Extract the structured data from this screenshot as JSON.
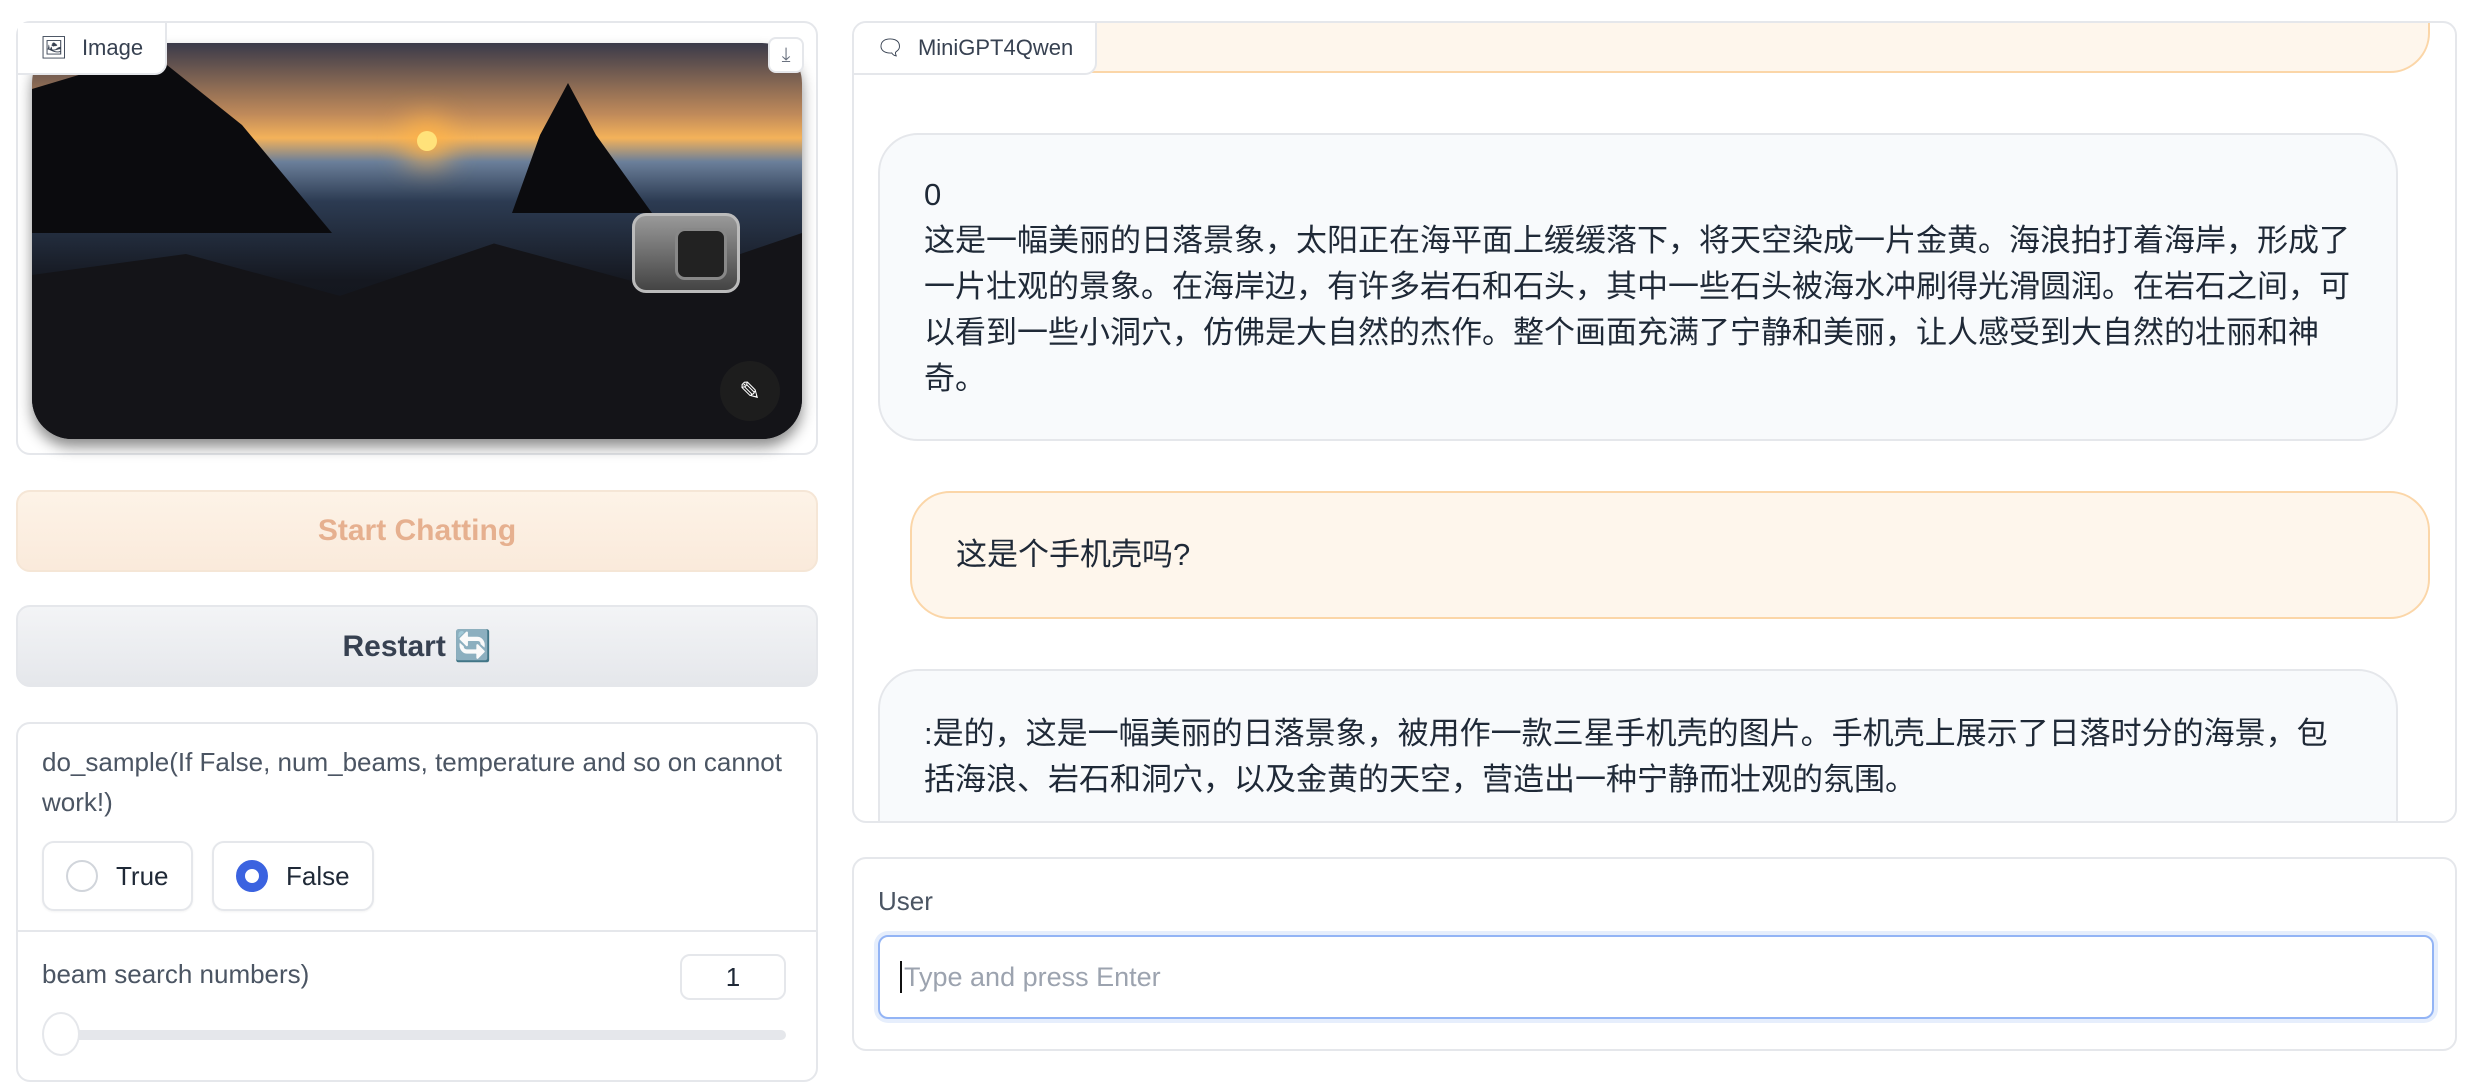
{
  "image_panel": {
    "label": "Image",
    "icon": "image-icon",
    "download_icon": "download-icon",
    "edit_icon": "magic-wand-icon"
  },
  "buttons": {
    "start": "Start Chatting",
    "restart": "Restart 🔄"
  },
  "settings": {
    "do_sample_label": "do_sample(If False, num_beams, temperature and so on cannot work!)",
    "options": [
      "True",
      "False"
    ],
    "selected": "False",
    "beam_label": "beam search numbers)",
    "beam_value": "1",
    "beam_slider_value": 1
  },
  "chat": {
    "label": "MiniGPT4Qwen",
    "icon": "chat-icon",
    "messages": [
      {
        "role": "bot",
        "lines": [
          "0",
          "这是一幅美丽的日落景象，太阳正在海平面上缓缓落下，将天空染成一片金黄。海浪拍打着海岸，形成了一片壮观的景象。在海岸边，有许多岩石和石头，其中一些石头被海水冲刷得光滑圆润。在岩石之间，可以看到一些小洞穴，仿佛是大自然的杰作。整个画面充满了宁静和美丽，让人感受到大自然的壮丽和神奇。"
        ]
      },
      {
        "role": "user",
        "lines": [
          "这是个手机壳吗?"
        ]
      },
      {
        "role": "bot",
        "lines": [
          ":是的，这是一幅美丽的日落景象，被用作一款三星手机壳的图片。手机壳上展示了日落时分的海景，包括海浪、岩石和洞穴，以及金黄的天空，营造出一种宁静而壮观的氛围。"
        ]
      }
    ]
  },
  "user_input": {
    "label": "User",
    "placeholder": "Type and press Enter",
    "value": ""
  },
  "colors": {
    "accent": "#3b63e0",
    "user_bubble": "#fef6ec",
    "bot_bubble": "#f8fafc"
  }
}
